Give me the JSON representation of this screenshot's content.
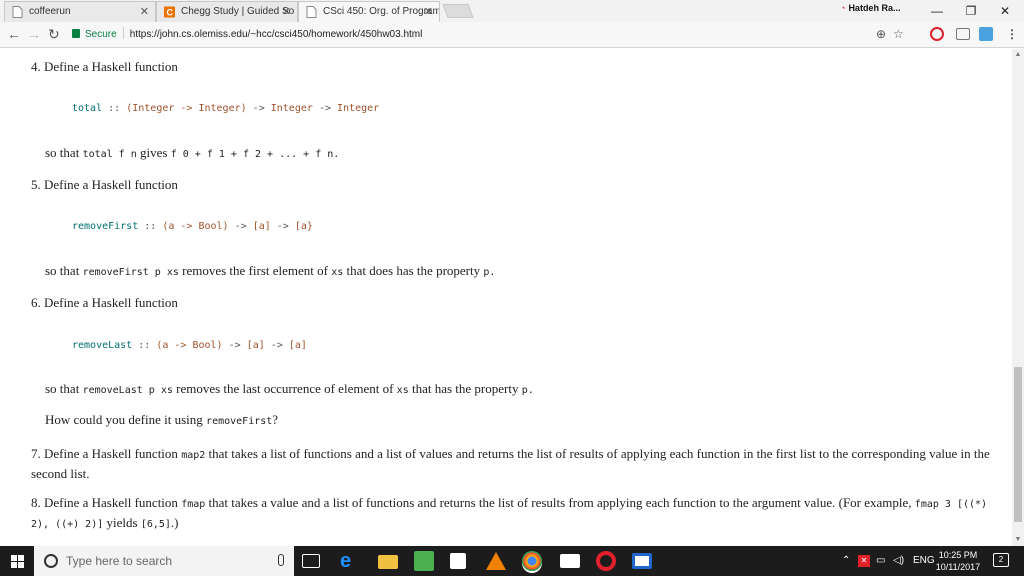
{
  "browser": {
    "tabs": [
      {
        "title": "coffeerun"
      },
      {
        "title": "Chegg Study | Guided So"
      },
      {
        "title": "CSci 450: Org. of Program"
      }
    ],
    "profile_label": "Hatdeh Ra...",
    "address": {
      "secure_label": "Secure",
      "url": "https://john.cs.olemiss.edu/~hcc/csci450/homework/450hw03.html"
    }
  },
  "content": {
    "q4": {
      "heading": "4. Define a Haskell function",
      "sig": {
        "name": "total",
        "colons": "::",
        "p1": "(Integer -> Integer)",
        "arrow1": "->",
        "t2": "Integer",
        "arrow2": "->",
        "t3": "Integer"
      },
      "desc_pre": "so that",
      "desc_code1": "total f n",
      "desc_mid": "gives",
      "desc_code2": "f 0 + f 1 + f 2 + ... + f n."
    },
    "q5": {
      "heading": "5. Define a Haskell function",
      "sig": {
        "name": "removeFirst",
        "colons": "::",
        "p1": "(a -> Bool)",
        "arrow1": "->",
        "t2": "[a]",
        "arrow2": "->",
        "t3": "[a}"
      },
      "desc_pre": "so that",
      "desc_code1": "removeFirst p xs",
      "desc_mid": "removes the first element of",
      "desc_code2": "xs",
      "desc_post": "that does has the property",
      "desc_code3": "p."
    },
    "q6": {
      "heading": "6. Define a Haskell function",
      "sig": {
        "name": "removeLast",
        "colons": "::",
        "p1": "(a -> Bool)",
        "arrow1": "->",
        "t2": "[a]",
        "arrow2": "->",
        "t3": "[a]"
      },
      "desc_pre": "so that",
      "desc_code1": "removeLast p xs",
      "desc_mid": "removes the last occurrence of element of",
      "desc_code2": "xs",
      "desc_post": "that has the property",
      "desc_code3": "p.",
      "q_pre": "How could you define it using",
      "q_code": "removeFirst",
      "q_post": "?"
    },
    "q7": {
      "pre": "7. Define a Haskell function",
      "code": "map2",
      "post": "that takes a list of functions and a list of values and returns the list of results of applying each function in the first list to the corresponding value in the second list."
    },
    "q8": {
      "pre": "8. Define a Haskell function",
      "code": "fmap",
      "post": "that takes a value and a list of functions and returns the list of results from applying each function to the argument value. (For example,",
      "code2": "fmap 3 [((*) 2), ((+) 2)]",
      "mid": "yields",
      "code3": "[6,5]",
      "end": ".)"
    }
  },
  "taskbar": {
    "search_placeholder": "Type here to search",
    "lang": "ENG",
    "time": "10:25 PM",
    "date": "10/11/2017",
    "notification_count": "2"
  }
}
